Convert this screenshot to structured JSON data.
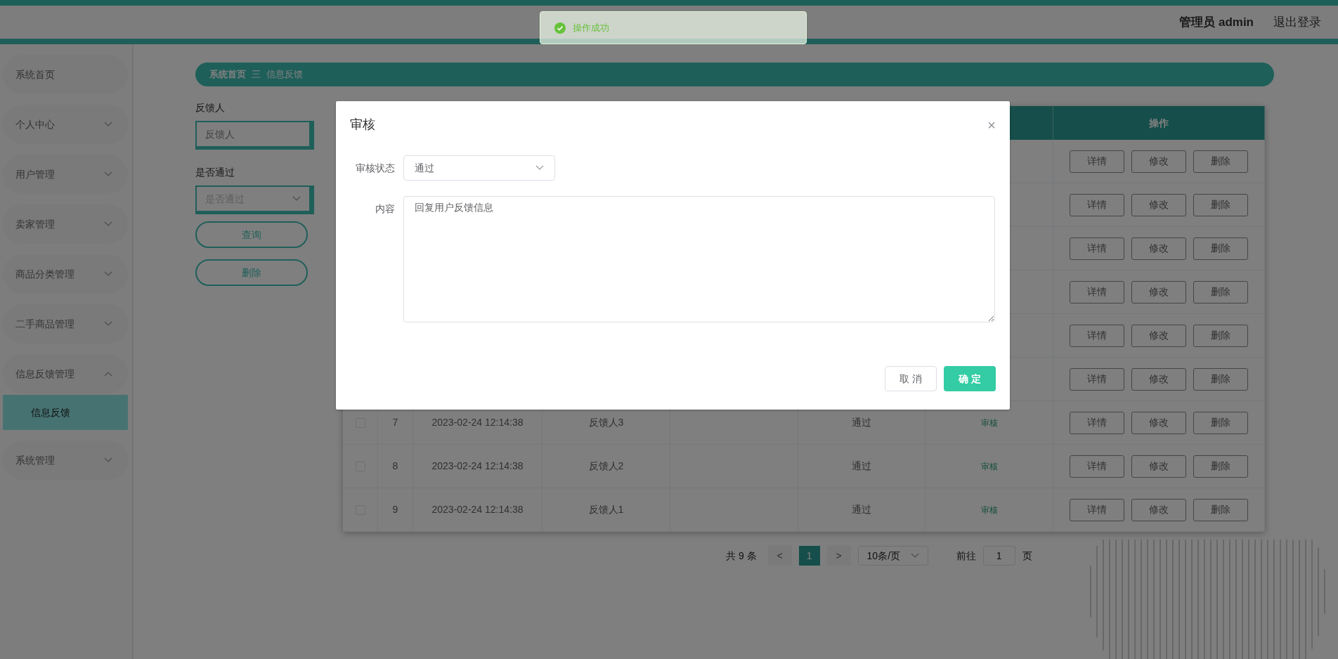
{
  "header": {
    "user": "管理员 admin",
    "logout": "退出登录"
  },
  "toast": {
    "message": "操作成功"
  },
  "sidebar": {
    "items": [
      {
        "label": "系统首页"
      },
      {
        "label": "个人中心",
        "expanded": false
      },
      {
        "label": "用户管理",
        "expanded": false
      },
      {
        "label": "卖家管理",
        "expanded": false
      },
      {
        "label": "商品分类管理",
        "expanded": false
      },
      {
        "label": "二手商品管理",
        "expanded": false
      },
      {
        "label": "信息反馈管理",
        "expanded": true,
        "children": [
          {
            "label": "信息反馈",
            "selected": true
          }
        ]
      },
      {
        "label": "系统管理",
        "expanded": false
      }
    ]
  },
  "breadcrumb": {
    "home": "系统首页",
    "separator": "三",
    "current": "信息反馈"
  },
  "filters": [
    {
      "kind": "input",
      "label": "反馈人",
      "placeholder": "反馈人"
    },
    {
      "kind": "select",
      "label": "是否通过",
      "placeholder": "是否通过"
    }
  ],
  "filter_buttons": [
    "查询",
    "删除"
  ],
  "table": {
    "columns": [
      {
        "label": "操作"
      }
    ],
    "rows": [
      {
        "actions": [
          "详情",
          "修改",
          "删除"
        ]
      },
      {
        "actions": [
          "详情",
          "修改",
          "删除"
        ]
      },
      {
        "actions": [
          "详情",
          "修改",
          "删除"
        ]
      },
      {
        "actions": [
          "详情",
          "修改",
          "删除"
        ]
      },
      {
        "actions": [
          "详情",
          "修改",
          "删除"
        ]
      },
      {
        "actions": [
          "详情",
          "修改",
          "删除"
        ]
      },
      {
        "checked": false,
        "index": "7",
        "time": "2023-02-24 12:14:38",
        "name": "反馈人3",
        "status": "通过",
        "review": "审核",
        "actions": [
          "详情",
          "修改",
          "删除"
        ]
      },
      {
        "checked": false,
        "index": "8",
        "time": "2023-02-24 12:14:38",
        "name": "反馈人2",
        "status": "通过",
        "review": "审核",
        "actions": [
          "详情",
          "修改",
          "删除"
        ]
      },
      {
        "checked": false,
        "index": "9",
        "time": "2023-02-24 12:14:38",
        "name": "反馈人1",
        "status": "通过",
        "review": "审核",
        "actions": [
          "详情",
          "修改",
          "删除"
        ]
      }
    ]
  },
  "pagination": {
    "total": "共 9 条",
    "prev": "<",
    "pages": [
      {
        "label": "1",
        "selected": true
      }
    ],
    "next": ">",
    "page_size": "10条/页",
    "goto_label": "前往",
    "goto_value": "1",
    "goto_suffix": "页"
  },
  "dialog": {
    "title": "审核",
    "close": "×",
    "fields": [
      {
        "kind": "select",
        "label": "审核状态",
        "value": "通过"
      },
      {
        "kind": "textarea",
        "label": "内容",
        "value": "回复用户反馈信息"
      }
    ],
    "buttons": [
      {
        "label": "取 消",
        "primary": false
      },
      {
        "label": "确 定",
        "primary": true
      }
    ]
  }
}
